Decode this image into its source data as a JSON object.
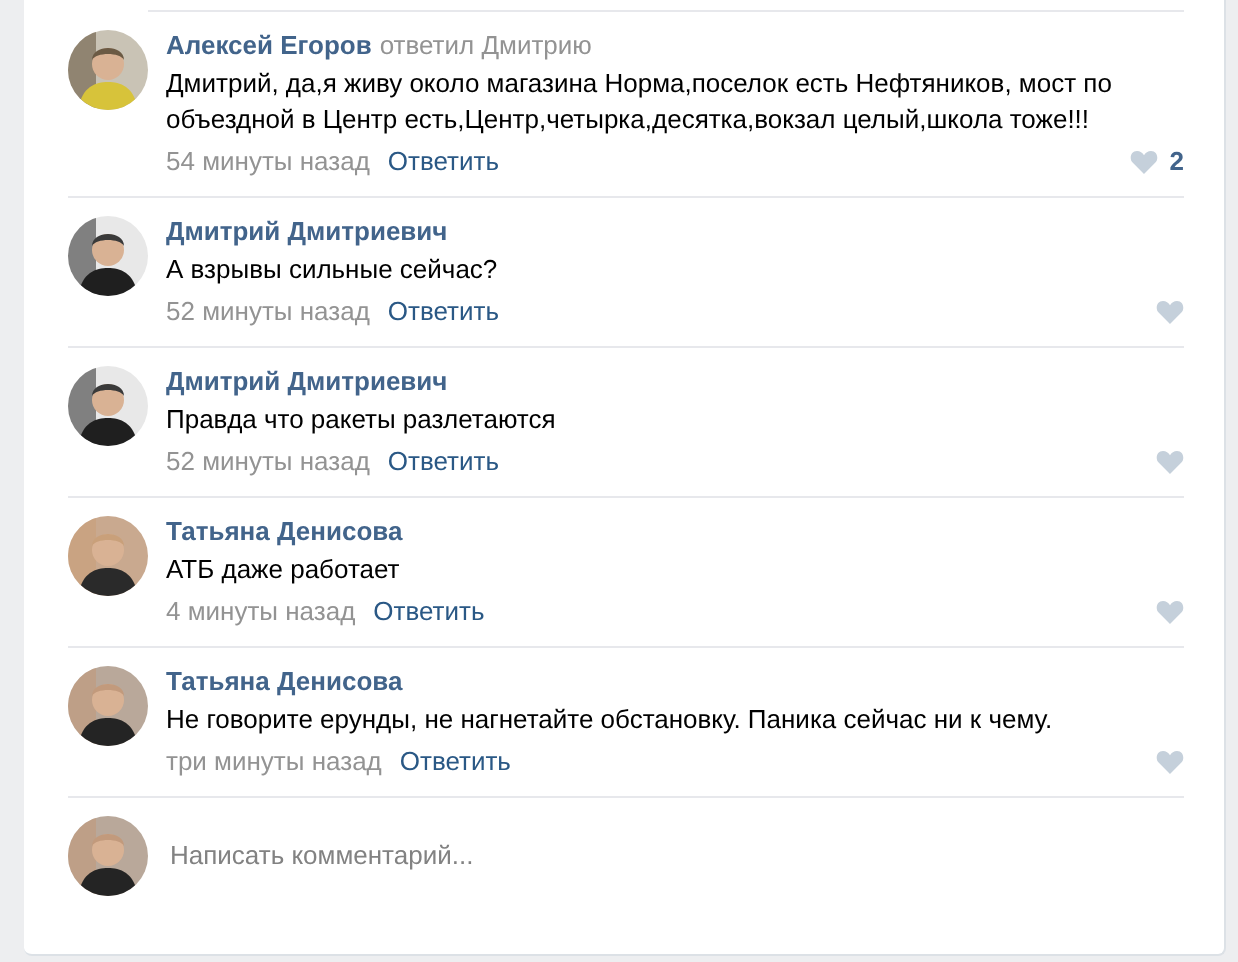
{
  "comments": [
    {
      "author": "Алексей Егоров",
      "reply_to": "ответил Дмитрию",
      "text": "Дмитрий, да,я живу около магазина Норма,поселок есть Нефтяников, мост по объездной в Центр есть,Центр,четырка,десятка,вокзал целый,школа тоже!!!",
      "time": "54 минуты назад",
      "reply": "Ответить",
      "likes": "2"
    },
    {
      "author": "Дмитрий Дмитриевич",
      "text": "А взрывы сильные сейчас?",
      "time": "52 минуты назад",
      "reply": "Ответить"
    },
    {
      "author": "Дмитрий Дмитриевич",
      "text": "Правда что ракеты разлетаются",
      "time": "52 минуты назад",
      "reply": "Ответить"
    },
    {
      "author": "Татьяна Денисова",
      "text": "АТБ даже работает",
      "time": "4 минуты назад",
      "reply": "Ответить"
    },
    {
      "author": "Татьяна Денисова",
      "text": "Не говорите ерунды, не нагнетайте обстановку. Паника сейчас ни к чему.",
      "time": "три минуты назад",
      "reply": "Ответить"
    }
  ],
  "composer": {
    "placeholder": "Написать комментарий..."
  }
}
